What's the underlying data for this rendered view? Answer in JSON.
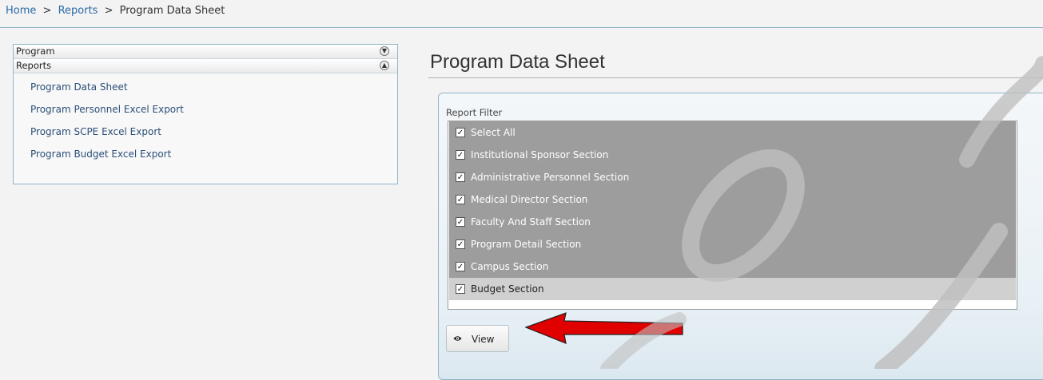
{
  "breadcrumb": {
    "home": "Home",
    "separator": ">",
    "reports": "Reports",
    "current": "Program Data Sheet"
  },
  "sidebar": {
    "sections": [
      {
        "label": "Program",
        "icon": "expand-down-icon"
      },
      {
        "label": "Reports",
        "icon": "collapse-up-icon"
      }
    ],
    "items": [
      {
        "label": "Program Data Sheet"
      },
      {
        "label": "Program Personnel Excel Export"
      },
      {
        "label": "Program SCPE Excel Export"
      },
      {
        "label": "Program Budget Excel Export"
      }
    ]
  },
  "main": {
    "title": "Program Data Sheet",
    "filter_label": "Report Filter",
    "filters": [
      {
        "label": "Select All",
        "checked": true
      },
      {
        "label": "Institutional Sponsor Section",
        "checked": true
      },
      {
        "label": "Administrative Personnel Section",
        "checked": true
      },
      {
        "label": "Medical Director Section",
        "checked": true
      },
      {
        "label": "Faculty And Staff Section",
        "checked": true
      },
      {
        "label": "Program Detail Section",
        "checked": true
      },
      {
        "label": "Campus Section",
        "checked": true
      },
      {
        "label": "Budget Section",
        "checked": true
      }
    ],
    "view_button": "View",
    "view_icon": "eye-icon"
  },
  "colors": {
    "link": "#2b6aa8",
    "border": "#8fb6c8",
    "selected_row": "#9d9d9d",
    "arrow": "#e00000"
  }
}
